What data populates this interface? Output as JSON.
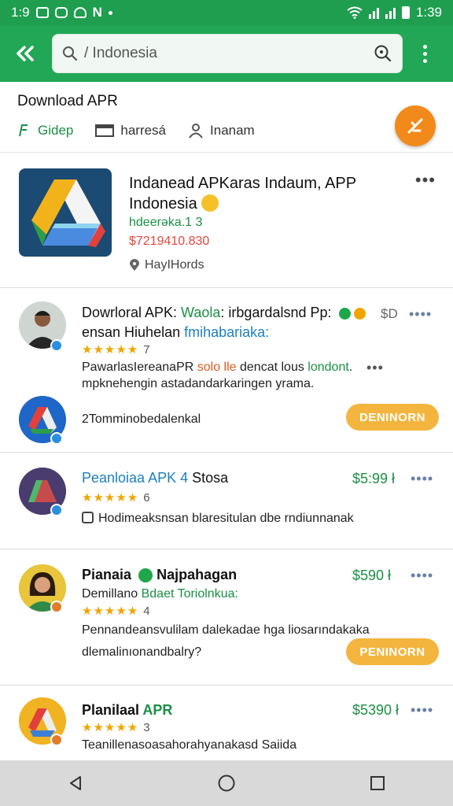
{
  "status_bar": {
    "time_left": "1:9",
    "time_right": "1:39"
  },
  "search": {
    "query": "/ Indonesia"
  },
  "header": {
    "title": "Download APR",
    "links": [
      {
        "label": "Gidep",
        "icon": "puzzle-icon"
      },
      {
        "label": "harresá",
        "icon": "folder-icon"
      },
      {
        "label": "Inanam",
        "icon": "person-icon"
      }
    ]
  },
  "featured": {
    "title_line1": "Indanead APKaras Indaum, APP",
    "title_line2": "Indonesia",
    "subtitle": "hdeerəka.1 3",
    "price": "$7219410.830",
    "location": "HayIHords"
  },
  "items": [
    {
      "title_main": "Dowrloral APK: ",
      "title_accent": "Waola",
      "title_rest": ": irbgardalsnd Pp:",
      "title_line2_a": "ensan Hiuhelan ",
      "title_line2_b": "fmihabariaka:",
      "rating_count": "7",
      "desc_a": "PawarlasIereanaPR ",
      "desc_b": "solo lle",
      "desc_c": " dencat lous ",
      "desc_d": "londont",
      "desc_e": ".",
      "desc_line2": "mpknehengin astadandarkaringen yrama.",
      "sub_label": "2Tomminobedalenkal",
      "price": "$D",
      "button": "DENINORN"
    },
    {
      "title": "Peanloiaa APK 4",
      "title_rest": " Stosa",
      "rating_count": "6",
      "desc": "Hodimeaksnsan blaresitulan dbe rndiunnanak",
      "price": "$5:99 ł"
    },
    {
      "title": "Pianaia",
      "title_rest": " Najpahagan",
      "subtitle_a": "Demillano ",
      "subtitle_b": "Bdaet Toriolnkua:",
      "rating_count": "4",
      "desc_line1": "Pennandeansvulilam dalekadae hga liosarındakaka",
      "desc_line2": "dlemalinıonandbalry?",
      "price": "$590 ł",
      "button": "PENINORN"
    },
    {
      "title": "Planilaal ",
      "title_accent": "APR",
      "rating_count": "3",
      "desc": "Teanillenasoasahorahyanakasd Saiida",
      "price": "$5390 ł"
    }
  ],
  "colors": {
    "primary": "#21a755",
    "accent": "#f28a1b",
    "button": "#f3b53d",
    "price": "#1a8f45"
  }
}
